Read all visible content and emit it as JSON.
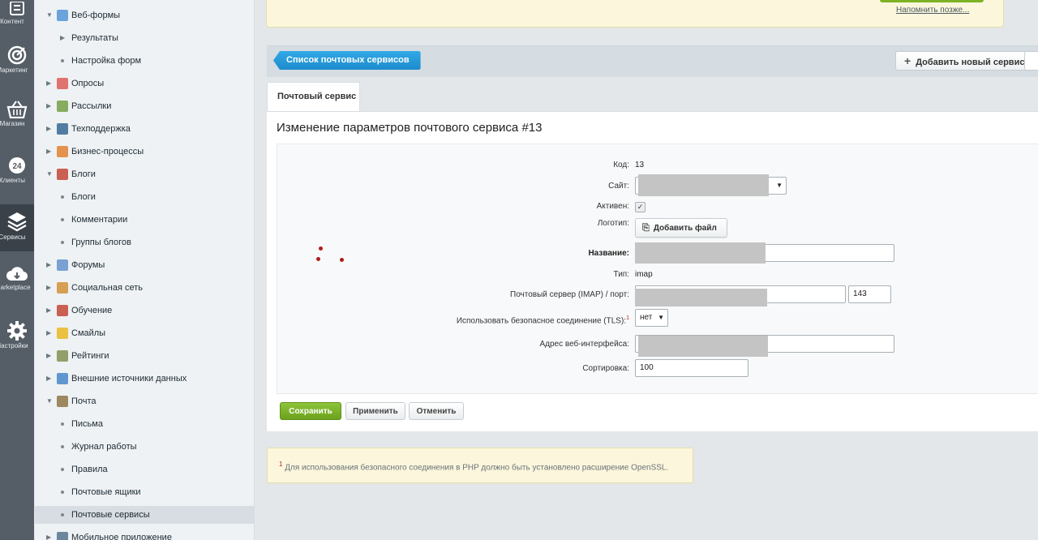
{
  "rail": {
    "items": [
      {
        "label": "Контент"
      },
      {
        "label": "Маркетинг"
      },
      {
        "label": "Магазин"
      },
      {
        "label": "Клиенты"
      },
      {
        "label": "Сервисы"
      },
      {
        "label": "Marketplace"
      },
      {
        "label": "Настройки"
      }
    ]
  },
  "menu": {
    "items": [
      {
        "label": "Веб-формы",
        "level": 1,
        "expanded": true,
        "icon": "form-icon"
      },
      {
        "label": "Результаты",
        "level": 2,
        "expander": true
      },
      {
        "label": "Настройка форм",
        "level": 2
      },
      {
        "label": "Опросы",
        "level": 1,
        "icon": "poll-icon"
      },
      {
        "label": "Рассылки",
        "level": 1,
        "icon": "mailing-icon"
      },
      {
        "label": "Техподдержка",
        "level": 1,
        "icon": "headset-icon"
      },
      {
        "label": "Бизнес-процессы",
        "level": 1,
        "icon": "process-icon"
      },
      {
        "label": "Блоги",
        "level": 1,
        "expanded": true,
        "icon": "blog-icon"
      },
      {
        "label": "Блоги",
        "level": 2
      },
      {
        "label": "Комментарии",
        "level": 2
      },
      {
        "label": "Группы блогов",
        "level": 2
      },
      {
        "label": "Форумы",
        "level": 1,
        "icon": "forum-icon"
      },
      {
        "label": "Социальная сеть",
        "level": 1,
        "icon": "social-icon"
      },
      {
        "label": "Обучение",
        "level": 1,
        "icon": "learning-icon"
      },
      {
        "label": "Смайлы",
        "level": 1,
        "icon": "smile-icon"
      },
      {
        "label": "Рейтинги",
        "level": 1,
        "icon": "rating-icon"
      },
      {
        "label": "Внешние источники данных",
        "level": 1,
        "icon": "rss-icon"
      },
      {
        "label": "Почта",
        "level": 1,
        "expanded": true,
        "icon": "mail-icon"
      },
      {
        "label": "Письма",
        "level": 2
      },
      {
        "label": "Журнал работы",
        "level": 2
      },
      {
        "label": "Правила",
        "level": 2
      },
      {
        "label": "Почтовые ящики",
        "level": 2
      },
      {
        "label": "Почтовые сервисы",
        "level": 2,
        "selected": true
      },
      {
        "label": "Мобильное приложение",
        "level": 1,
        "icon": "mobile-icon"
      }
    ]
  },
  "top_notice": {
    "remind_label": "Напомнить позже..."
  },
  "toolbar": {
    "back_label": "Список почтовых сервисов",
    "add_label": "Добавить новый сервис"
  },
  "tab": {
    "label": "Почтовый сервис"
  },
  "page_title": "Изменение параметров почтового сервиса #13",
  "form": {
    "code_label": "Код:",
    "code_value": "13",
    "site_label": "Сайт:",
    "active_label": "Активен:",
    "active_checked": true,
    "logo_label": "Логотип:",
    "add_file_label": "Добавить файл",
    "name_label": "Название:",
    "type_label": "Тип:",
    "type_value": "imap",
    "server_label": "Почтовый сервер (IMAP) / порт:",
    "port_value": "143",
    "tls_label": "Использовать безопасное соединение (TLS):",
    "tls_sup": "1",
    "tls_value": "нет",
    "web_label": "Адрес веб-интерфейса:",
    "sort_label": "Сортировка:",
    "sort_value": "100"
  },
  "buttons": {
    "save": "Сохранить",
    "apply": "Применить",
    "cancel": "Отменить"
  },
  "footnote": {
    "sup": "1",
    "text": "Для использования безопасного соединения в PHP должно быть установлено расширение OpenSSL."
  },
  "colors": {
    "save_green": "#76ad22",
    "back_blue": "#2299db",
    "rail_bg": "#555d66"
  }
}
